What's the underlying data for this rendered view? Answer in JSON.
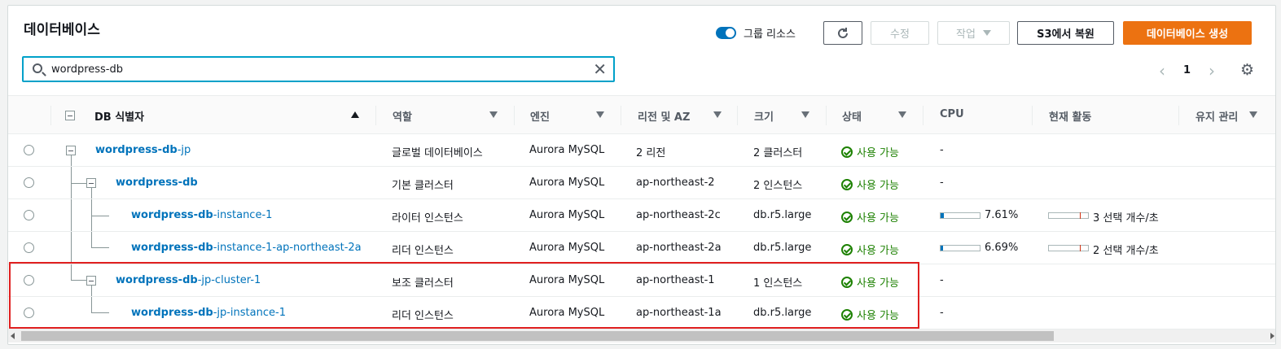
{
  "header": {
    "title": "데이터베이스",
    "toggle_label": "그룹 리소스",
    "buttons": {
      "edit": "수정",
      "actions": "작업",
      "restore_s3": "S3에서 복원",
      "create": "데이터베이스 생성"
    }
  },
  "search": {
    "value": "wordpress-db",
    "placeholder": ""
  },
  "pagination": {
    "page": "1"
  },
  "columns": {
    "identifier": "DB 식별자",
    "role": "역할",
    "engine": "엔진",
    "region": "리전 및 AZ",
    "size": "크기",
    "status": "상태",
    "cpu": "CPU",
    "activity": "현재 활동",
    "maintenance": "유지 관리"
  },
  "rows": [
    {
      "id_bold": "wordpress-db",
      "id_rest": "-jp",
      "role": "글로벌 데이터베이스",
      "engine": "Aurora MySQL",
      "region": "2 리전",
      "size": "2 클러스터",
      "status": "사용 가능",
      "cpu": "-",
      "activity": ""
    },
    {
      "id_bold": "wordpress-db",
      "id_rest": "",
      "role": "기본 클러스터",
      "engine": "Aurora MySQL",
      "region": "ap-northeast-2",
      "size": "2 인스턴스",
      "status": "사용 가능",
      "cpu": "-",
      "activity": ""
    },
    {
      "id_bold": "wordpress-db",
      "id_rest": "-instance-1",
      "role": "라이터 인스턴스",
      "engine": "Aurora MySQL",
      "region": "ap-northeast-2c",
      "size": "db.r5.large",
      "status": "사용 가능",
      "cpu": "7.61%",
      "cpu_fraction": 0.0761,
      "activity": "3 선택 개수/초"
    },
    {
      "id_bold": "wordpress-db",
      "id_rest": "-instance-1-ap-northeast-2a",
      "role": "리더 인스턴스",
      "engine": "Aurora MySQL",
      "region": "ap-northeast-2a",
      "size": "db.r5.large",
      "status": "사용 가능",
      "cpu": "6.69%",
      "cpu_fraction": 0.0669,
      "activity": "2 선택 개수/초"
    },
    {
      "id_bold": "wordpress-db",
      "id_rest": "-jp-cluster-1",
      "role": "보조 클러스터",
      "engine": "Aurora MySQL",
      "region": "ap-northeast-1",
      "size": "1 인스턴스",
      "status": "사용 가능",
      "cpu": "-",
      "activity": ""
    },
    {
      "id_bold": "wordpress-db",
      "id_rest": "-jp-instance-1",
      "role": "리더 인스턴스",
      "engine": "Aurora MySQL",
      "region": "ap-northeast-1a",
      "size": "db.r5.large",
      "status": "사용 가능",
      "cpu": "-",
      "activity": ""
    }
  ],
  "colors": {
    "accent": "#ec7211",
    "link": "#0073bb",
    "status_ok": "#1d8102",
    "highlight": "#e02020"
  }
}
